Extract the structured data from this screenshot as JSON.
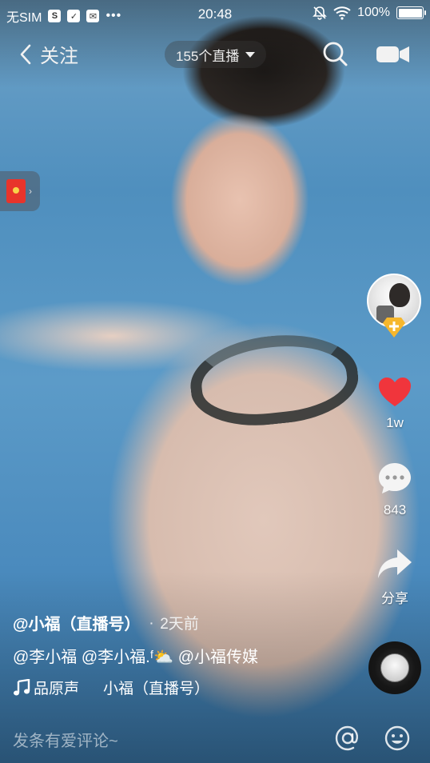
{
  "status_bar": {
    "carrier": "无SIM",
    "time": "20:48",
    "battery": "100%",
    "battery_level": 1.0
  },
  "top_nav": {
    "back_label": "关注",
    "live_count": "155个直播"
  },
  "right_rail": {
    "like_count": "1w",
    "comment_count": "843",
    "share_label": "分享"
  },
  "post": {
    "author": "@小福（直播号）",
    "separator": "·",
    "time_ago": "2天前",
    "caption": "@李小福 @李小福.ᶠ⛅ @小福传媒",
    "music_title": "品原声",
    "music_artist": "小福（直播号）"
  },
  "comment_bar": {
    "placeholder": "发条有爱评论~"
  },
  "colors": {
    "like_red": "#f0353c",
    "red_packet": "#e8342b",
    "follow_gold": "#f6b72d"
  },
  "icons": [
    "back-icon",
    "search-icon",
    "camera-icon",
    "red-packet-icon",
    "heart-icon",
    "comment-icon",
    "share-icon",
    "music-note-icon",
    "at-icon",
    "emoji-icon"
  ]
}
